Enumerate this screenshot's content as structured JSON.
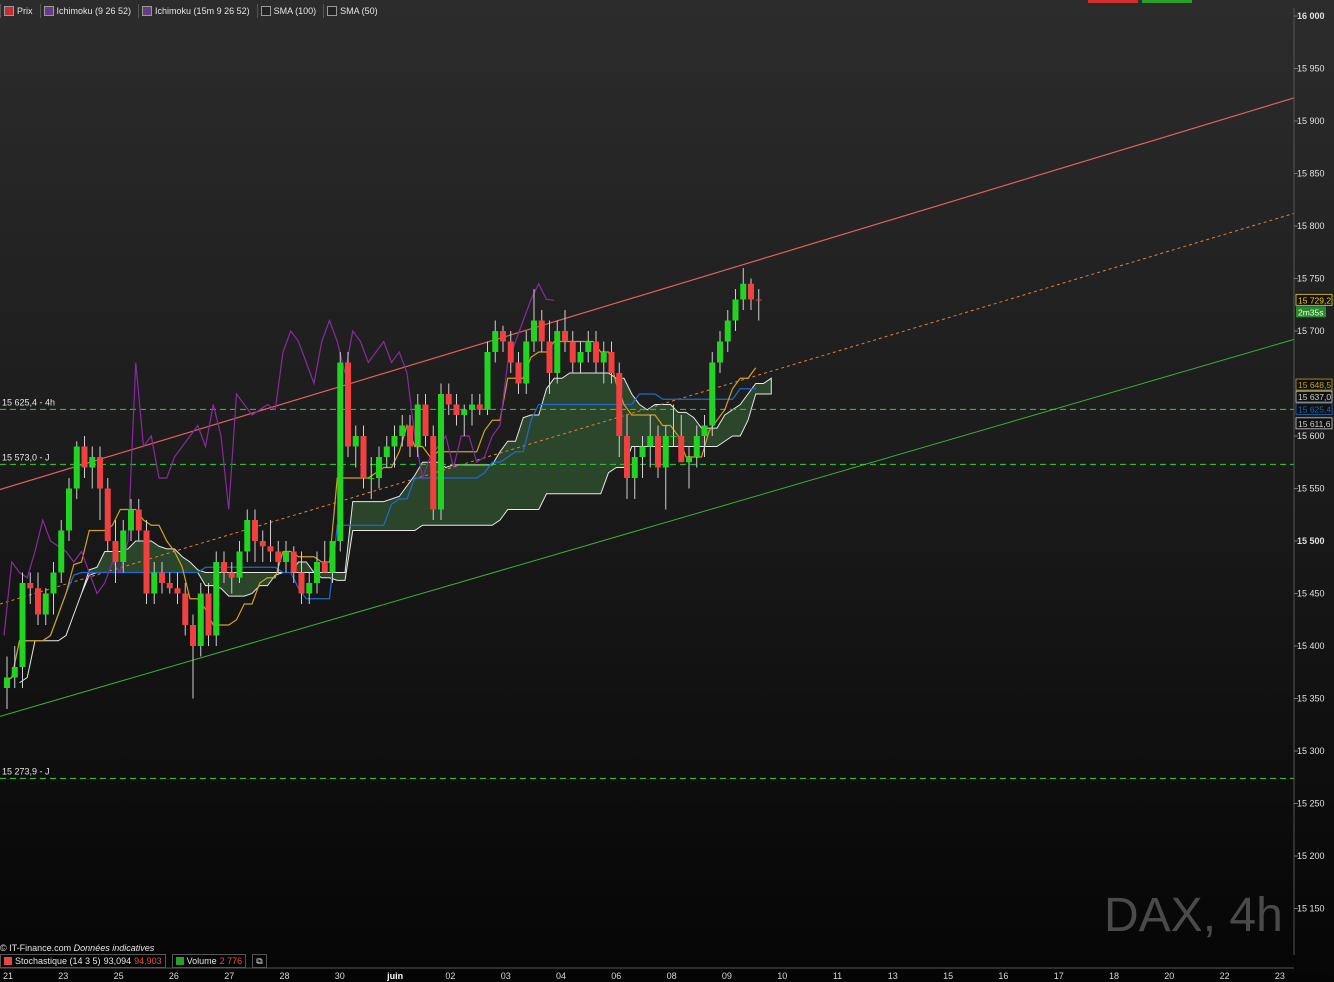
{
  "chart_data": {
    "type": "candlestick",
    "instrument": "DAX",
    "timeframe": "4h",
    "watermark": "DAX, 4h",
    "ylim": [
      15100,
      16000
    ],
    "y_ticks": [
      {
        "value": 16000,
        "label": "16 000"
      },
      {
        "value": 15950,
        "label": "15 950"
      },
      {
        "value": 15900,
        "label": "15 900"
      },
      {
        "value": 15850,
        "label": "15 850"
      },
      {
        "value": 15800,
        "label": "15 800"
      },
      {
        "value": 15750,
        "label": "15 750"
      },
      {
        "value": 15700,
        "label": "15 700"
      },
      {
        "value": 15600,
        "label": "15 600"
      },
      {
        "value": 15550,
        "label": "15 550"
      },
      {
        "value": 15500,
        "label": "15 500"
      },
      {
        "value": 15450,
        "label": "15 450"
      },
      {
        "value": 15400,
        "label": "15 400"
      },
      {
        "value": 15350,
        "label": "15 350"
      },
      {
        "value": 15300,
        "label": "15 300"
      },
      {
        "value": 15250,
        "label": "15 250"
      },
      {
        "value": 15200,
        "label": "15 200"
      },
      {
        "value": 15150,
        "label": "15 150"
      }
    ],
    "x_ticks": [
      "21",
      "23",
      "25",
      "26",
      "27",
      "28",
      "30",
      "juin",
      "02",
      "03",
      "04",
      "06",
      "08",
      "09",
      "10",
      "11",
      "13",
      "15",
      "16",
      "17",
      "18",
      "20",
      "22",
      "23"
    ],
    "candles": [
      [
        15360,
        15390,
        15340,
        15370
      ],
      [
        15370,
        15400,
        15360,
        15380
      ],
      [
        15380,
        15470,
        15360,
        15460
      ],
      [
        15460,
        15470,
        15440,
        15455
      ],
      [
        15455,
        15470,
        15420,
        15430
      ],
      [
        15430,
        15455,
        15420,
        15450
      ],
      [
        15450,
        15480,
        15430,
        15470
      ],
      [
        15470,
        15520,
        15460,
        15510
      ],
      [
        15510,
        15560,
        15500,
        15550
      ],
      [
        15550,
        15595,
        15540,
        15590
      ],
      [
        15590,
        15600,
        15560,
        15570
      ],
      [
        15570,
        15590,
        15550,
        15580
      ],
      [
        15580,
        15590,
        15520,
        15550
      ],
      [
        15550,
        15560,
        15490,
        15500
      ],
      [
        15500,
        15520,
        15460,
        15480
      ],
      [
        15480,
        15520,
        15470,
        15510
      ],
      [
        15510,
        15540,
        15500,
        15530
      ],
      [
        15530,
        15540,
        15500,
        15510
      ],
      [
        15510,
        15520,
        15440,
        15450
      ],
      [
        15450,
        15480,
        15440,
        15470
      ],
      [
        15470,
        15480,
        15450,
        15460
      ],
      [
        15460,
        15470,
        15450,
        15455
      ],
      [
        15455,
        15470,
        15440,
        15450
      ],
      [
        15450,
        15460,
        15410,
        15420
      ],
      [
        15420,
        15430,
        15350,
        15400
      ],
      [
        15400,
        15460,
        15390,
        15450
      ],
      [
        15450,
        15460,
        15400,
        15410
      ],
      [
        15410,
        15490,
        15400,
        15480
      ],
      [
        15480,
        15490,
        15460,
        15470
      ],
      [
        15470,
        15480,
        15450,
        15465
      ],
      [
        15465,
        15500,
        15460,
        15490
      ],
      [
        15490,
        15530,
        15480,
        15520
      ],
      [
        15520,
        15530,
        15480,
        15500
      ],
      [
        15500,
        15510,
        15480,
        15495
      ],
      [
        15495,
        15520,
        15480,
        15490
      ],
      [
        15490,
        15500,
        15470,
        15480
      ],
      [
        15480,
        15500,
        15470,
        15490
      ],
      [
        15490,
        15495,
        15460,
        15470
      ],
      [
        15470,
        15490,
        15440,
        15450
      ],
      [
        15450,
        15470,
        15440,
        15460
      ],
      [
        15460,
        15490,
        15450,
        15480
      ],
      [
        15480,
        15500,
        15470,
        15470
      ],
      [
        15470,
        15500,
        15460,
        15500
      ],
      [
        15500,
        15680,
        15490,
        15670
      ],
      [
        15670,
        15680,
        15580,
        15590
      ],
      [
        15590,
        15610,
        15570,
        15600
      ],
      [
        15600,
        15610,
        15550,
        15560
      ],
      [
        15560,
        15580,
        15540,
        15560
      ],
      [
        15560,
        15590,
        15550,
        15580
      ],
      [
        15580,
        15600,
        15570,
        15590
      ],
      [
        15590,
        15610,
        15570,
        15600
      ],
      [
        15600,
        15620,
        15590,
        15610
      ],
      [
        15610,
        15620,
        15580,
        15590
      ],
      [
        15590,
        15640,
        15580,
        15630
      ],
      [
        15630,
        15640,
        15590,
        15600
      ],
      [
        15600,
        15610,
        15520,
        15530
      ],
      [
        15530,
        15650,
        15520,
        15640
      ],
      [
        15640,
        15650,
        15620,
        15630
      ],
      [
        15630,
        15640,
        15610,
        15620
      ],
      [
        15620,
        15630,
        15600,
        15625
      ],
      [
        15625,
        15640,
        15610,
        15630
      ],
      [
        15630,
        15640,
        15620,
        15625
      ],
      [
        15625,
        15690,
        15620,
        15680
      ],
      [
        15680,
        15710,
        15670,
        15700
      ],
      [
        15700,
        15705,
        15680,
        15690
      ],
      [
        15690,
        15700,
        15660,
        15670
      ],
      [
        15670,
        15680,
        15640,
        15650
      ],
      [
        15650,
        15700,
        15640,
        15690
      ],
      [
        15690,
        15740,
        15680,
        15710
      ],
      [
        15710,
        15720,
        15680,
        15690
      ],
      [
        15690,
        15710,
        15640,
        15660
      ],
      [
        15660,
        15710,
        15650,
        15700
      ],
      [
        15700,
        15720,
        15680,
        15690
      ],
      [
        15690,
        15700,
        15660,
        15670
      ],
      [
        15670,
        15690,
        15660,
        15680
      ],
      [
        15680,
        15700,
        15670,
        15690
      ],
      [
        15690,
        15700,
        15660,
        15670
      ],
      [
        15670,
        15690,
        15650,
        15680
      ],
      [
        15680,
        15690,
        15650,
        15660
      ],
      [
        15660,
        15670,
        15580,
        15600
      ],
      [
        15600,
        15620,
        15540,
        15560
      ],
      [
        15560,
        15590,
        15540,
        15580
      ],
      [
        15580,
        15600,
        15560,
        15590
      ],
      [
        15590,
        15620,
        15570,
        15600
      ],
      [
        15600,
        15610,
        15560,
        15570
      ],
      [
        15570,
        15610,
        15530,
        15600
      ],
      [
        15600,
        15630,
        15590,
        15600
      ],
      [
        15600,
        15620,
        15580,
        15575
      ],
      [
        15575,
        15590,
        15550,
        15580
      ],
      [
        15580,
        15610,
        15570,
        15600
      ],
      [
        15600,
        15620,
        15580,
        15610
      ],
      [
        15610,
        15680,
        15600,
        15670
      ],
      [
        15670,
        15700,
        15660,
        15690
      ],
      [
        15690,
        15720,
        15680,
        15710
      ],
      [
        15710,
        15740,
        15700,
        15730
      ],
      [
        15730,
        15760,
        15720,
        15745
      ],
      [
        15745,
        15750,
        15720,
        15730
      ],
      [
        15730,
        15740,
        15710,
        15729.2
      ]
    ],
    "horizontal_levels": [
      {
        "value": 15625.4,
        "label": "15 625,4 - 4h"
      },
      {
        "value": 15573.0,
        "label": "15 573,0 - J"
      },
      {
        "value": 15273.9,
        "label": "15 273,9 - J"
      }
    ],
    "price_labels": [
      {
        "value": 15729.2,
        "label": "15 729,2",
        "color": "#f5d21e"
      },
      {
        "value": 15648.5,
        "label": "15 648,5",
        "color": "#c8a020"
      },
      {
        "value": 15637.0,
        "label": "15 637,0",
        "color": "#d0d0d0"
      },
      {
        "value": 15625.4,
        "label": "15 625,4",
        "color": "#2266bb"
      },
      {
        "value": 15611.6,
        "label": "15 611,6",
        "color": "#d0d0d0"
      }
    ],
    "countdown": "2m35s",
    "colors": {
      "up": "#22d422",
      "down": "#f04040",
      "cloud": "#2e4d2e",
      "tenkan": "#d4a020",
      "kijun": "#1e6ad0",
      "chikou": "#8a2aa0",
      "channel_top": "#e06060",
      "channel_mid": "#e08040",
      "channel_bottom": "#3ab03a",
      "level": "#2ad22a"
    }
  },
  "legend": [
    {
      "label": "Prix"
    },
    {
      "label": "Ichimoku (9 26 52)"
    },
    {
      "label": "Ichimoku (15m 9 26 52)"
    },
    {
      "label": "SMA (100)"
    },
    {
      "label": "SMA (50)"
    }
  ],
  "credit": "© IT-Finance.com",
  "credit_note": "Données indicatives",
  "indicators": {
    "stoch_label": "Stochastique (14 3 5)",
    "stoch_value1": "93,094",
    "stoch_value2": "94,903",
    "volume_label": "Volume",
    "volume_value": "2 776"
  }
}
